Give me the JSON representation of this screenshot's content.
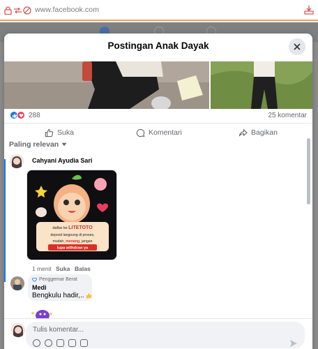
{
  "browser": {
    "url": "www.facebook.com"
  },
  "modal": {
    "title": "Postingan Anak Dayak",
    "reactions_count": "288",
    "comments_count": "25 komentar",
    "actions": {
      "like": "Suka",
      "comment": "Komentari",
      "share": "Bagikan"
    },
    "sort_label": "Paling relevan"
  },
  "comments": [
    {
      "author": "Cahyani Ayudia Sari",
      "sticker": {
        "line1": "daftar ke",
        "brand": "LITETOTO",
        "line2": "deposit langsung di proses,",
        "line3_a": "mudah",
        "line3_b": "menang",
        "line3_c": ", jangan",
        "line4": "lupa withdraw ya"
      },
      "time": "1 menit",
      "like": "Suka",
      "reply": "Balas"
    },
    {
      "badge": "Penggemar Berat",
      "author": "Medi",
      "text": "Bengkulu hadir,.."
    }
  ],
  "composer": {
    "placeholder": "Tulis komentar..."
  },
  "colors": {
    "accent": "#1877f2",
    "chrome_border": "#f5a25d",
    "like_blue": "#1877f2",
    "love_red": "#f33e58"
  }
}
